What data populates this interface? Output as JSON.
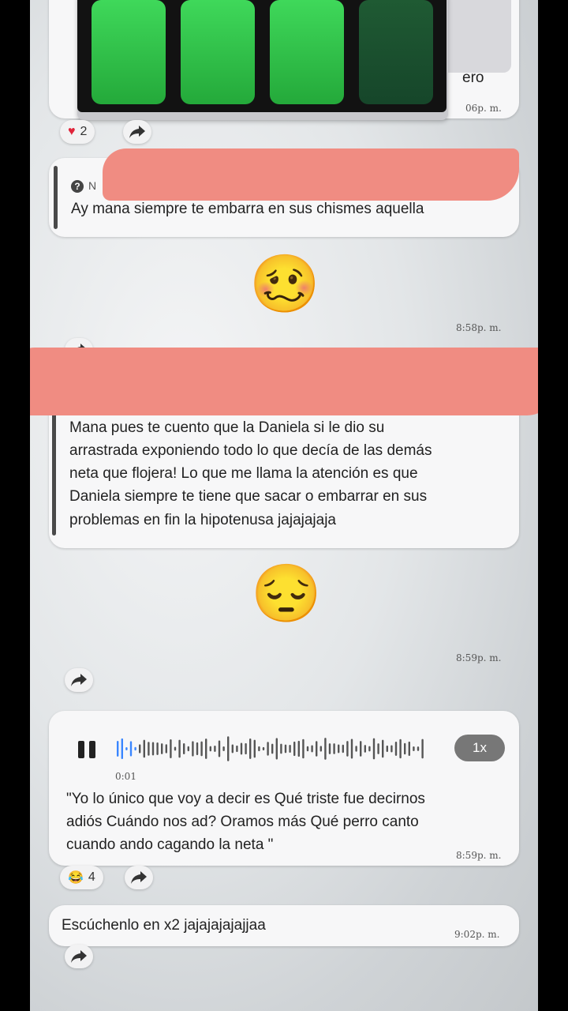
{
  "battery_overlay": {
    "bars_full": 3,
    "bars_total": 4
  },
  "message1": {
    "partial_text": "ero",
    "time": "06p. m.",
    "reaction_count": "2"
  },
  "message2": {
    "quote_sender": "N",
    "quote_text": "Ay mana siempre te embarra en sus chismes aquella",
    "emoji": "🥴",
    "time": "8:58p. m."
  },
  "message3": {
    "quote_lines": [
      "Mana pues te cuento que la Daniela si le dio su",
      "arrastrada exponiendo todo lo que decía de las demás",
      "neta que flojera! Lo que me llama la atención es que",
      "Daniela siempre te tiene que sacar o embarrar en sus",
      "problemas en fin la hipotenusa jajajajaja"
    ],
    "emoji": "😔",
    "time": "8:59p. m."
  },
  "voice_message": {
    "elapsed": "0:01",
    "speed": "1x",
    "transcript_lines": [
      "\"Yo lo único que voy a decir es Qué triste fue decirnos",
      "adiós Cuándo nos ad? Oramos más Qué perro canto",
      "cuando ando cagando la neta \""
    ],
    "time": "8:59p. m.",
    "reaction_emoji": "😂",
    "reaction_count": "4"
  },
  "message5": {
    "text": "Escúchenlo en x2 jajajajajajjaa",
    "time": "9:02p. m."
  },
  "colors": {
    "battery_green": "#2fc84a",
    "redaction": "#f08c82",
    "waveform_played": "#3a86ff"
  }
}
